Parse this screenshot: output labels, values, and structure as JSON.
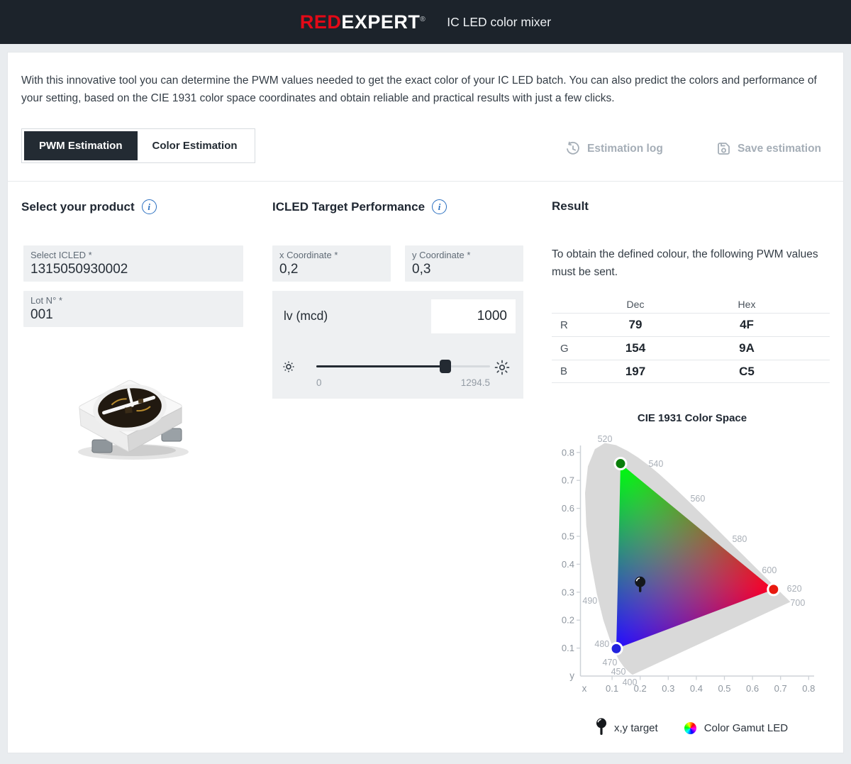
{
  "header": {
    "brand_red": "RED",
    "brand_rest": "EXPERT",
    "brand_reg": "®",
    "app_title": "IC LED color mixer"
  },
  "intro": "With this innovative tool you can determine the PWM values needed to get the exact color of your IC LED batch. You can also predict the colors and performance of your setting, based on the CIE 1931 color space coordinates and obtain reliable and practical results with just a few clicks.",
  "tabs": [
    {
      "label": "PWM Estimation",
      "active": true
    },
    {
      "label": "Color Estimation",
      "active": false
    }
  ],
  "actions": {
    "estimation_log": "Estimation log",
    "save_estimation": "Save estimation"
  },
  "product": {
    "heading": "Select your product",
    "icled_label": "Select ICLED *",
    "icled_value": "1315050930002",
    "lot_label": "Lot N° *",
    "lot_value": "001"
  },
  "target": {
    "heading": "ICLED Target Performance",
    "x_label": "x Coordinate *",
    "x_value": "0,2",
    "y_label": "y Coordinate *",
    "y_value": "0,3",
    "lv_label": "lv (mcd)",
    "lv_value": "1000",
    "slider_min": "0",
    "slider_max": "1294.5"
  },
  "result": {
    "heading": "Result",
    "description": "To obtain the defined colour, the following PWM values must be sent.",
    "table": {
      "columns": [
        "Dec",
        "Hex"
      ],
      "rows": [
        {
          "channel": "R",
          "dec": "79",
          "hex": "4F"
        },
        {
          "channel": "G",
          "dec": "154",
          "hex": "9A"
        },
        {
          "channel": "B",
          "dec": "197",
          "hex": "C5"
        }
      ]
    }
  },
  "chart_data": {
    "type": "scatter",
    "title": "CIE 1931 Color Space",
    "xlabel": "x",
    "ylabel": "y",
    "xlim": [
      0,
      0.85
    ],
    "ylim": [
      0,
      0.9
    ],
    "x_ticks": [
      0.1,
      0.2,
      0.3,
      0.4,
      0.5,
      0.6,
      0.7,
      0.8
    ],
    "y_ticks": [
      0.1,
      0.2,
      0.3,
      0.4,
      0.5,
      0.6,
      0.7,
      0.8
    ],
    "grid": false,
    "locus_fill": "#d9d9d9",
    "locus": [
      [
        0.1741,
        0.005
      ],
      [
        0.1726,
        0.0048
      ],
      [
        0.1689,
        0.0069
      ],
      [
        0.1644,
        0.0109
      ],
      [
        0.1566,
        0.0177
      ],
      [
        0.144,
        0.0297
      ],
      [
        0.1241,
        0.0578
      ],
      [
        0.1096,
        0.0868
      ],
      [
        0.0913,
        0.1327
      ],
      [
        0.0687,
        0.2007
      ],
      [
        0.0454,
        0.295
      ],
      [
        0.0235,
        0.4127
      ],
      [
        0.0082,
        0.5384
      ],
      [
        0.0039,
        0.6548
      ],
      [
        0.0139,
        0.7502
      ],
      [
        0.0389,
        0.812
      ],
      [
        0.0743,
        0.8338
      ],
      [
        0.1142,
        0.8262
      ],
      [
        0.1547,
        0.8059
      ],
      [
        0.1929,
        0.7816
      ],
      [
        0.2296,
        0.7543
      ],
      [
        0.2658,
        0.7243
      ],
      [
        0.3016,
        0.6923
      ],
      [
        0.3373,
        0.6589
      ],
      [
        0.3731,
        0.6245
      ],
      [
        0.4087,
        0.5896
      ],
      [
        0.4441,
        0.5547
      ],
      [
        0.4788,
        0.5202
      ],
      [
        0.5125,
        0.4866
      ],
      [
        0.5448,
        0.4544
      ],
      [
        0.5752,
        0.4242
      ],
      [
        0.6029,
        0.3965
      ],
      [
        0.627,
        0.3725
      ],
      [
        0.6482,
        0.3514
      ],
      [
        0.6658,
        0.334
      ],
      [
        0.6801,
        0.3197
      ],
      [
        0.6915,
        0.3083
      ],
      [
        0.7079,
        0.292
      ],
      [
        0.719,
        0.2809
      ],
      [
        0.726,
        0.274
      ],
      [
        0.7334,
        0.2666
      ],
      [
        0.7347,
        0.2653
      ]
    ],
    "gamut": {
      "vertices": [
        {
          "name": "green",
          "x": 0.13,
          "y": 0.76,
          "dot_color": "#0a7e0a",
          "mix_color": "#00ff00"
        },
        {
          "name": "red",
          "x": 0.675,
          "y": 0.31,
          "dot_color": "#e8190f",
          "mix_color": "#ff0000"
        },
        {
          "name": "blue",
          "x": 0.115,
          "y": 0.098,
          "dot_color": "#2222dd",
          "mix_color": "#0000ff"
        }
      ]
    },
    "target": {
      "x": 0.2,
      "y": 0.3
    },
    "wavelength_labels": [
      {
        "t": "520",
        "x": 0.0745,
        "y": 0.848
      },
      {
        "t": "540",
        "x": 0.256,
        "y": 0.759
      },
      {
        "t": "560",
        "x": 0.405,
        "y": 0.634
      },
      {
        "t": "580",
        "x": 0.554,
        "y": 0.49
      },
      {
        "t": "600",
        "x": 0.66,
        "y": 0.378
      },
      {
        "t": "620",
        "x": 0.749,
        "y": 0.312
      },
      {
        "t": "700",
        "x": 0.761,
        "y": 0.261
      },
      {
        "t": "490",
        "x": 0.021,
        "y": 0.269
      },
      {
        "t": "480",
        "x": 0.064,
        "y": 0.114
      },
      {
        "t": "470",
        "x": 0.092,
        "y": 0.048
      },
      {
        "t": "450",
        "x": 0.1225,
        "y": 0.015
      },
      {
        "t": "400",
        "x": 0.163,
        "y": -0.023
      }
    ],
    "legend": [
      {
        "icon": "pin-icon",
        "label": "x,y target"
      },
      {
        "icon": "rainbow-icon",
        "label": "Color Gamut LED"
      }
    ]
  }
}
